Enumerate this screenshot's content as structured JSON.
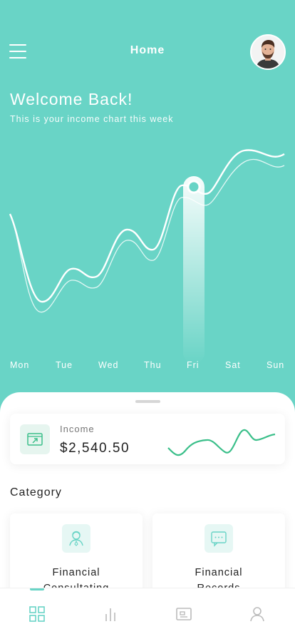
{
  "header": {
    "title": "Home"
  },
  "welcome": {
    "title": "Welcome Back!",
    "subtitle": "This is your income chart this week"
  },
  "chart_data": {
    "type": "line",
    "categories": [
      "Mon",
      "Tue",
      "Wed",
      "Thu",
      "Fri",
      "Sat",
      "Sun"
    ],
    "highlighted": "Fri",
    "grid": false,
    "legend": "none"
  },
  "income_card": {
    "label": "Income",
    "value": "$2,540.50"
  },
  "category": {
    "title": "Category",
    "items": [
      {
        "label_line1": "Financial",
        "label_line2": "Consultating"
      },
      {
        "label_line1": "Financial",
        "label_line2": "Records"
      }
    ]
  },
  "bottom_nav": {
    "items": [
      "grid-icon",
      "bar-chart-icon",
      "wallet-icon",
      "user-icon"
    ],
    "active": 0
  },
  "colors": {
    "accent": "#69d4c6",
    "sparkline": "#3bbf8a"
  }
}
